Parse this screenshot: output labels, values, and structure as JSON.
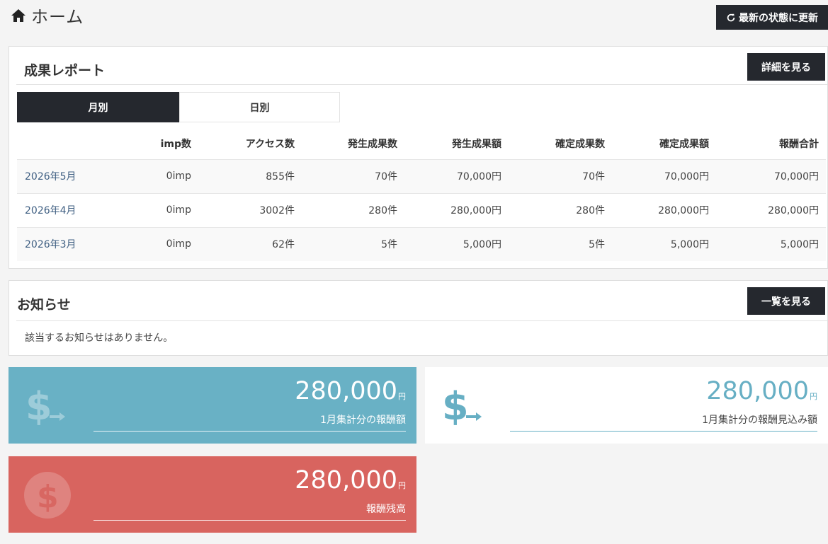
{
  "header": {
    "title": "ホーム",
    "refresh_label": "最新の状態に更新"
  },
  "report": {
    "title": "成果レポート",
    "detail_button": "詳細を見る",
    "tabs": [
      {
        "label": "月別",
        "active": true
      },
      {
        "label": "日別",
        "active": false
      }
    ],
    "columns": [
      "",
      "imp数",
      "アクセス数",
      "発生成果数",
      "発生成果額",
      "確定成果数",
      "確定成果額",
      "報酬合計"
    ],
    "rows": [
      {
        "month": "2026年5月",
        "imp": "0imp",
        "access": "855件",
        "gen_count": "70件",
        "gen_amount": "70,000円",
        "conf_count": "70件",
        "conf_amount": "70,000円",
        "total": "70,000円"
      },
      {
        "month": "2026年4月",
        "imp": "0imp",
        "access": "3002件",
        "gen_count": "280件",
        "gen_amount": "280,000円",
        "conf_count": "280件",
        "conf_amount": "280,000円",
        "total": "280,000円"
      },
      {
        "month": "2026年3月",
        "imp": "0imp",
        "access": "62件",
        "gen_count": "5件",
        "gen_amount": "5,000円",
        "conf_count": "5件",
        "conf_amount": "5,000円",
        "total": "5,000円"
      }
    ]
  },
  "news": {
    "title": "お知らせ",
    "list_button": "一覧を見る",
    "empty_message": "該当するお知らせはありません。"
  },
  "cards": {
    "reward": {
      "amount": "280,000",
      "unit": "円",
      "label": "1月集計分の報酬額",
      "color": "#69b1c5",
      "icon": "dollar-arrow-icon"
    },
    "expected": {
      "amount": "280,000",
      "unit": "円",
      "label": "1月集計分の報酬見込み額",
      "color": "#67afc4",
      "icon": "dollar-arrow-icon"
    },
    "balance": {
      "amount": "280,000",
      "unit": "円",
      "label": "報酬残高",
      "color": "#d8645f",
      "icon": "dollar-circle-icon"
    }
  }
}
